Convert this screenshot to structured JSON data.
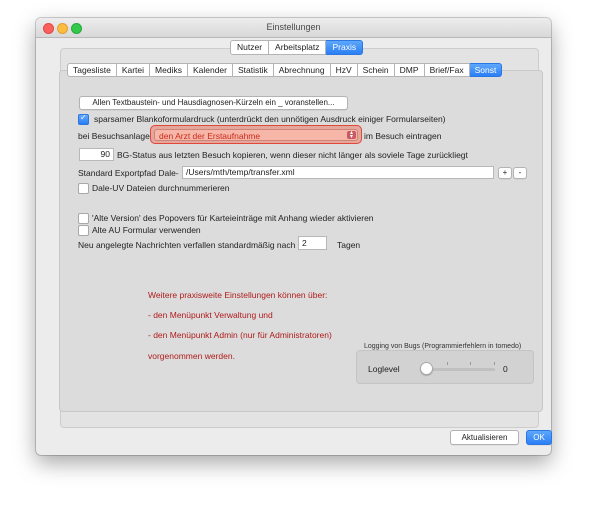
{
  "window": {
    "title": "Einstellungen"
  },
  "top_tabs": [
    {
      "label": "Nutzer",
      "active": false
    },
    {
      "label": "Arbeitsplatz",
      "active": false
    },
    {
      "label": "Praxis",
      "active": true
    }
  ],
  "sub_tabs": [
    {
      "label": "Tagesliste"
    },
    {
      "label": "Kartei"
    },
    {
      "label": "Mediks"
    },
    {
      "label": "Kalender"
    },
    {
      "label": "Statistik"
    },
    {
      "label": "Abrechnung"
    },
    {
      "label": "HzV"
    },
    {
      "label": "Schein"
    },
    {
      "label": "DMP"
    },
    {
      "label": "Brief/Fax"
    },
    {
      "label": "Sonst"
    }
  ],
  "settings": {
    "prefix_button": "Allen Textbaustein- und Hausdiagnosen-Kürzeln ein _ voranstellen...",
    "blank_form_checkbox": "sparsamer Blankoformulardruck (unterdrückt den unnötigen Ausdruck einiger Formularseiten)",
    "visit_prefix": "bei Besuchsanlage",
    "visit_select_value": "den Arzt der Erstaufnahme",
    "visit_suffix": "im Besuch eintragen",
    "bg_days_value": "90",
    "bg_status_label": "BG-Status aus letzten Besuch kopieren, wenn dieser nicht länger als soviele Tage zurückliegt",
    "export_path_label": "Standard Exportpfad Dale-",
    "export_path_value": "/Users/mth/temp/transfer.xml",
    "plus_label": "+",
    "minus_label": "-",
    "dale_uv_checkbox": "Dale-UV Dateien durchnummerieren",
    "alte_version_checkbox": "'Alte Version' des Popovers für Karteieinträge mit Anhang wieder aktivieren",
    "alte_au_checkbox": "Alte AU Formular verwenden",
    "messages_label": "Neu angelegte Nachrichten verfallen standardmäßig nach",
    "messages_days_value": "2",
    "messages_unit": "Tagen"
  },
  "info": {
    "line1": "Weitere praxisweite Einstellungen können über:",
    "line2": "- den Menüpunkt Verwaltung und",
    "line3": "- den Menüpunkt Admin (nur für Administratoren)",
    "line4": "vorgenommen werden."
  },
  "logging": {
    "title": "Logging von Bugs (Programmierfehlern in tomedo)",
    "label": "Loglevel",
    "value": "0",
    "level_fraction": 0
  },
  "footer": {
    "refresh_label": "Aktualisieren",
    "ok_label": "OK"
  }
}
